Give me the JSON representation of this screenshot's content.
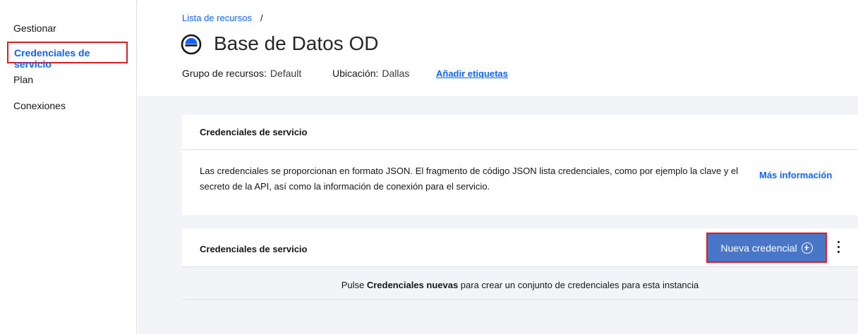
{
  "sidebar": {
    "items": [
      {
        "label": "Gestionar"
      },
      {
        "label": "Credenciales de servicio"
      },
      {
        "label": "Plan"
      },
      {
        "label": "Conexiones"
      }
    ]
  },
  "header": {
    "breadcrumb": "Lista de recursos",
    "breadcrumb_sep": "/",
    "title": "Base de Datos OD",
    "resource_group_label": "Grupo de recursos:",
    "resource_group_value": "Default",
    "location_label": "Ubicación:",
    "location_value": "Dallas",
    "add_tags": "Añadir etiquetas"
  },
  "info_card": {
    "title": "Credenciales de servicio",
    "text": "Las credenciales se proporcionan en formato JSON. El fragmento de código JSON lista credenciales, como por ejemplo la clave y el secreto de la API, así como la información de conexión para el servicio.",
    "more_info": "Más información"
  },
  "credentials_card": {
    "title": "Credenciales de servicio",
    "new_button": "Nueva credencial",
    "empty_prefix": "Pulse ",
    "empty_bold": "Credenciales nuevas",
    "empty_suffix": " para crear un conjunto de credenciales para esta instancia"
  },
  "colors": {
    "accent": "#0f62fe",
    "highlight_border": "#da1e28",
    "button_bg": "#4a76c7",
    "main_bg": "#f2f4f8"
  },
  "icons": {
    "title": "database-service-icon",
    "button": "add-circle-icon",
    "menu": "overflow-menu-icon"
  }
}
